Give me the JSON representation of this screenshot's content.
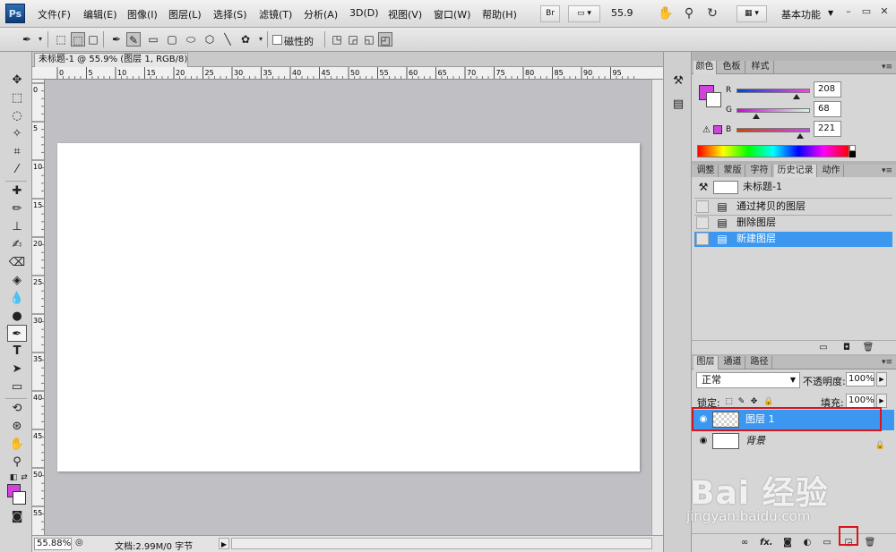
{
  "app": {
    "logo": "Ps"
  },
  "menu": {
    "items": [
      "文件(F)",
      "编辑(E)",
      "图像(I)",
      "图层(L)",
      "选择(S)",
      "滤镜(T)",
      "分析(A)",
      "3D(D)",
      "视图(V)",
      "窗口(W)",
      "帮助(H)"
    ],
    "bridge": "Br",
    "zoom_level": "55.9",
    "workspace": "基本功能"
  },
  "options": {
    "magnetic_label": "磁性的"
  },
  "document": {
    "tab_title": "未标题-1 @ 55.9% (图层 1, RGB/8) *",
    "h_ruler_ticks": [
      "0",
      "5",
      "10",
      "15",
      "20",
      "25",
      "30",
      "35",
      "40",
      "45",
      "50",
      "55",
      "60",
      "65",
      "70",
      "75",
      "80",
      "85",
      "90",
      "95"
    ],
    "v_ruler_ticks": [
      "0",
      "5",
      "10",
      "15",
      "20",
      "25",
      "30",
      "35",
      "40",
      "45",
      "50",
      "55"
    ]
  },
  "status": {
    "zoom": "55.88%",
    "doc_info": "文档:2.99M/0 字节"
  },
  "color_panel": {
    "tabs": [
      "颜色",
      "色板",
      "样式"
    ],
    "foreground_hex": "#d044dd",
    "channels": [
      {
        "label": "R",
        "value": "208",
        "fraction": 0.816
      },
      {
        "label": "G",
        "value": "68",
        "fraction": 0.267
      },
      {
        "label": "B",
        "value": "221",
        "fraction": 0.867
      }
    ]
  },
  "history_panel": {
    "tabs": [
      "调整",
      "蒙版",
      "字符",
      "历史记录",
      "动作"
    ],
    "snapshot": "未标题-1",
    "states": [
      "通过拷贝的图层",
      "删除图层",
      "新建图层"
    ]
  },
  "layers_panel": {
    "tabs": [
      "图层",
      "通道",
      "路径"
    ],
    "blend_mode": "正常",
    "opacity_label": "不透明度:",
    "opacity": "100%",
    "lock_label": "锁定:",
    "fill_label": "填充:",
    "fill": "100%",
    "layers": [
      {
        "name": "图层 1",
        "selected": true
      },
      {
        "name": "背景",
        "selected": false,
        "locked": true
      }
    ],
    "footer_fx": "fx."
  },
  "watermark": {
    "brand": "Bai 经验",
    "url": "jingyan.baidu.com"
  }
}
